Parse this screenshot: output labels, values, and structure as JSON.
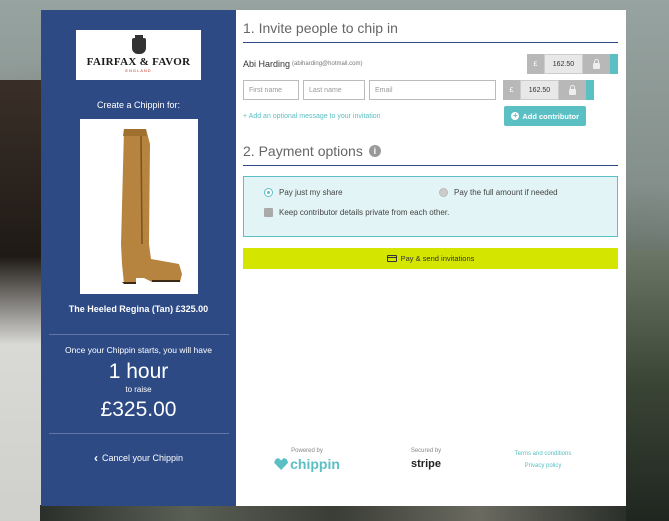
{
  "brand": {
    "name": "FAIRFAX & FAVOR",
    "sub": "ENGLAND"
  },
  "sidebar": {
    "create_for": "Create a Chippin for:",
    "product_name": "The Heeled Regina (Tan) £325.00",
    "starts_text": "Once your Chippin starts, you will have",
    "time_value": "1 hour",
    "to_raise": "to raise",
    "amount": "£325.00",
    "cancel": "Cancel your Chippin"
  },
  "invite": {
    "title": "1. Invite people to chip in",
    "contributor": {
      "name": "Abi Harding",
      "email": "(abiharding@hotmail.com)",
      "currency": "£",
      "amount": "162.50"
    },
    "new_row": {
      "first_placeholder": "First name",
      "last_placeholder": "Last name",
      "email_placeholder": "Email",
      "currency": "£",
      "amount": "162.50"
    },
    "add_message": "+ Add an optional message to your invitation",
    "add_contributor": "Add contributor"
  },
  "payment": {
    "title": "2. Payment options",
    "option_share": "Pay just my share",
    "option_full": "Pay the full amount if needed",
    "private_label": "Keep contributor details private from each other.",
    "selected": "share",
    "pay_button": "Pay & send invitations"
  },
  "footer": {
    "powered_by": "Powered by",
    "chippin_logo": "chippin",
    "secured_by": "Secured by",
    "stripe_logo": "stripe",
    "terms": "Terms and conditions",
    "privacy": "Privacy policy"
  },
  "colors": {
    "sidebar": "#2d4a85",
    "accent": "#5bc0c4",
    "pay_button": "#d4e600"
  }
}
